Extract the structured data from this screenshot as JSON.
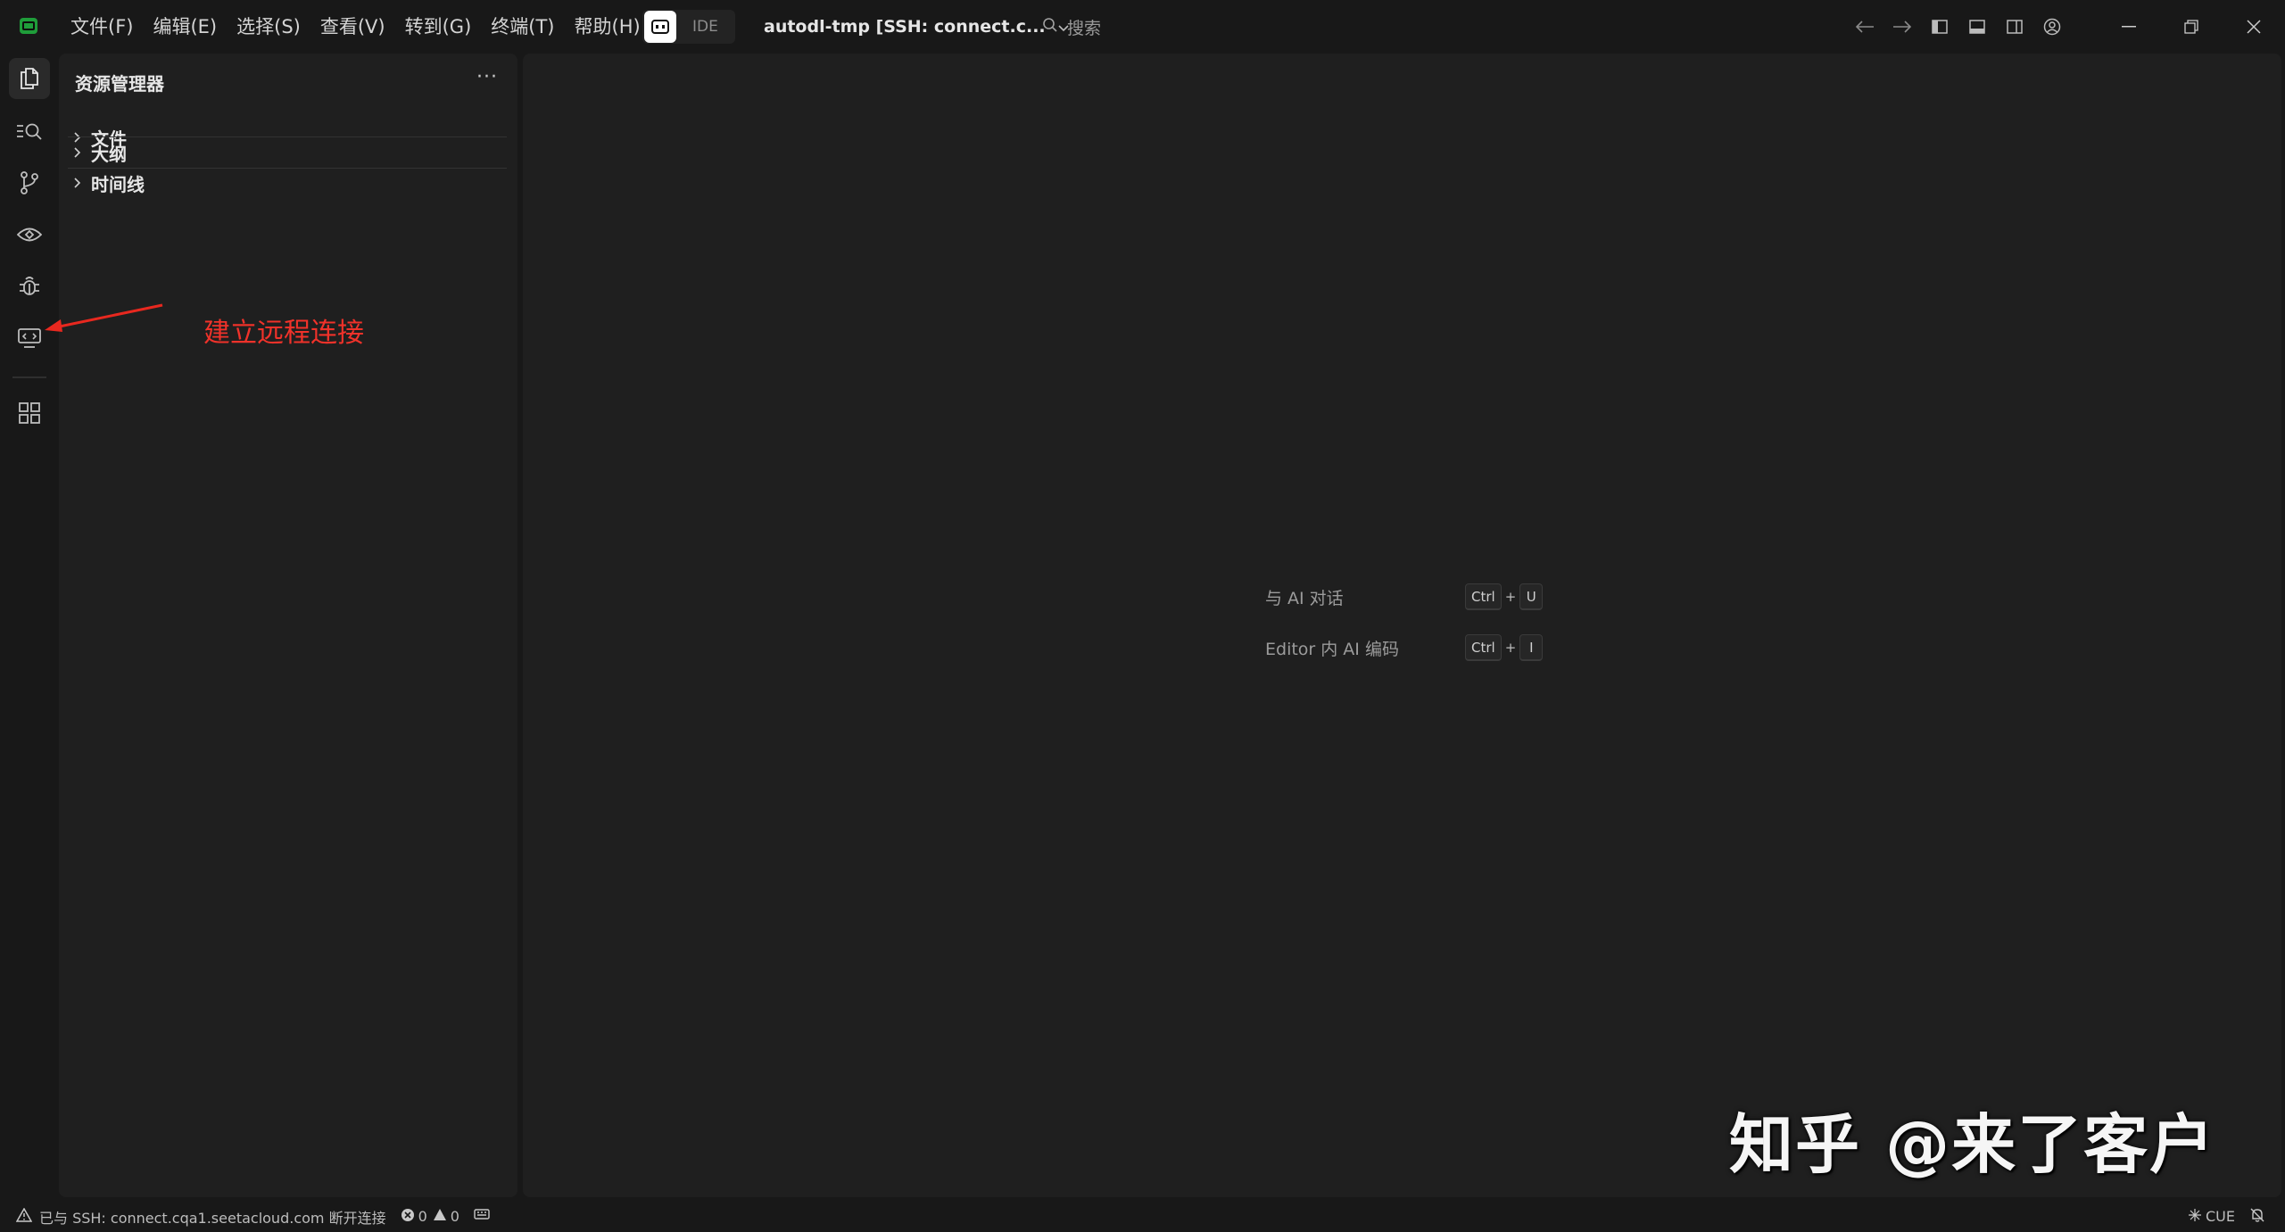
{
  "menu": [
    "文件(F)",
    "编辑(E)",
    "选择(S)",
    "查看(V)",
    "转到(G)",
    "终端(T)",
    "帮助(H)"
  ],
  "mode_toggle": {
    "label": "IDE"
  },
  "workspace": {
    "title": "autodl-tmp [SSH: connect.c..."
  },
  "search": {
    "placeholder": "搜索"
  },
  "icons": {
    "activity": [
      "files-icon",
      "search-icon",
      "source-control-icon",
      "eye-icon",
      "debug-icon",
      "remote-explorer-icon",
      "extensions-icon"
    ],
    "titlebar_right": [
      "arrow-left-icon",
      "arrow-right-icon",
      "toggle-sidebar-icon",
      "toggle-panel-icon",
      "toggle-secondary-sidebar-icon",
      "account-icon"
    ],
    "window": [
      "minimize-icon",
      "restore-icon",
      "close-icon"
    ]
  },
  "sidebar": {
    "title": "资源管理器",
    "more": "···",
    "sections": [
      "文件",
      "大纲",
      "时间线"
    ]
  },
  "annotation": {
    "text": "建立远程连接"
  },
  "editor": {
    "hints": [
      {
        "label": "与 AI 对话",
        "keys": [
          "Ctrl",
          "U"
        ]
      },
      {
        "label": "Editor 内 AI 编码",
        "keys": [
          "Ctrl",
          "I"
        ]
      }
    ],
    "key_plus": "+"
  },
  "watermark": "知乎 @来了客户",
  "statusbar": {
    "remote": "已与 SSH: connect.cqa1.seetacloud.com 断开连接",
    "errors": "0",
    "warnings": "0",
    "language": "CUE"
  },
  "colors": {
    "background": "#181818",
    "panel": "#1f1f1f",
    "logo": "#1f9d3a",
    "annotation": "#f0322a"
  }
}
